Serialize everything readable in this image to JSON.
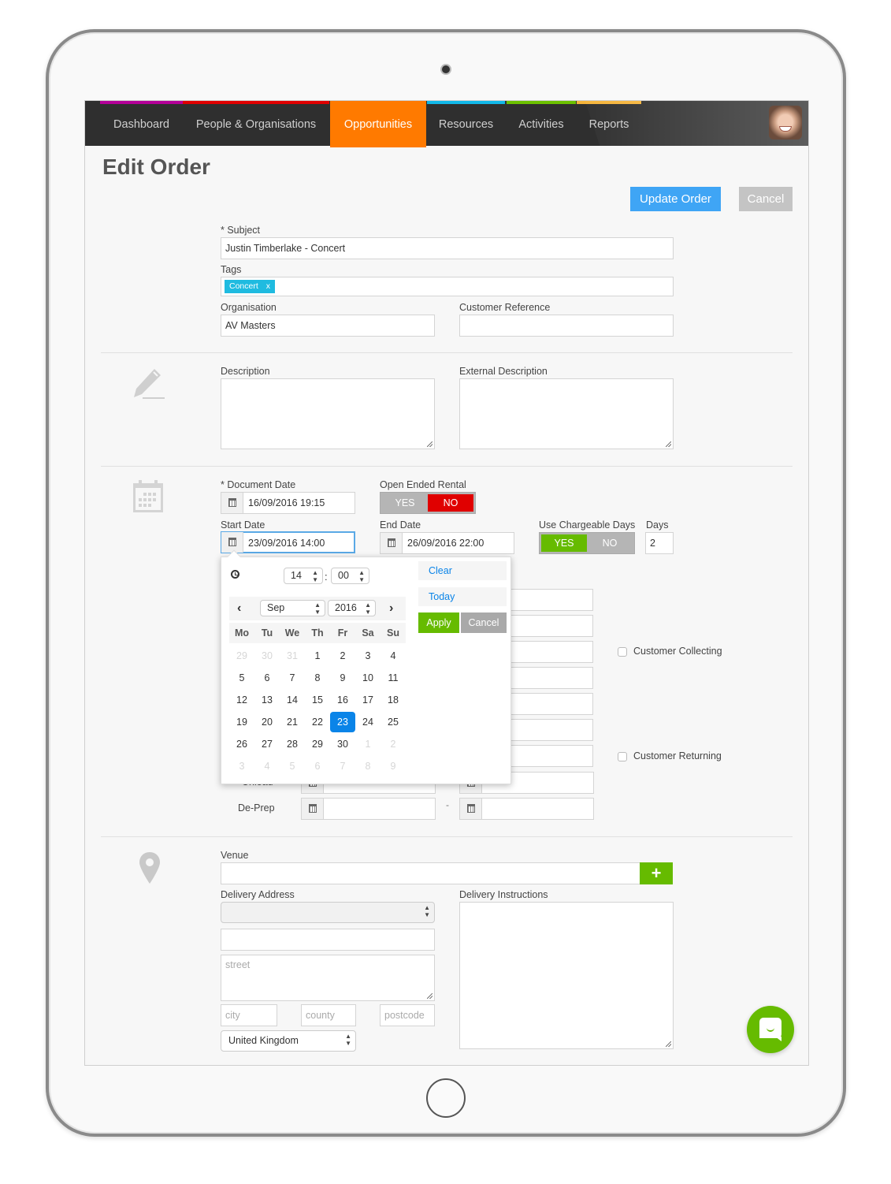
{
  "nav": {
    "items": [
      {
        "label": "Dashboard",
        "color": "#b40098"
      },
      {
        "label": "People & Organisations",
        "color": "#e00000"
      },
      {
        "label": "Opportunities",
        "color": "#ff7a00",
        "active": true
      },
      {
        "label": "Resources",
        "color": "#12b8e8"
      },
      {
        "label": "Activities",
        "color": "#6cc100"
      },
      {
        "label": "Reports",
        "color": "#f5b43a"
      }
    ],
    "active_color": "#ff7a00"
  },
  "header": {
    "title": "Edit Order",
    "update_label": "Update Order",
    "cancel_label": "Cancel"
  },
  "form": {
    "subject": {
      "label": "* Subject",
      "value": "Justin Timberlake - Concert"
    },
    "tags": {
      "label": "Tags",
      "items": [
        {
          "text": "Concert",
          "remove": "x"
        }
      ]
    },
    "organisation": {
      "label": "Organisation",
      "value": "AV Masters"
    },
    "customer_reference": {
      "label": "Customer Reference",
      "value": ""
    },
    "description": {
      "label": "Description",
      "value": ""
    },
    "external_description": {
      "label": "External Description",
      "value": ""
    },
    "document_date": {
      "label": "* Document Date",
      "value": "16/09/2016 19:15"
    },
    "open_ended_rental": {
      "label": "Open Ended Rental",
      "yes": "YES",
      "no": "NO",
      "selected": "NO"
    },
    "start_date": {
      "label": "Start Date",
      "value": "23/09/2016 14:00"
    },
    "end_date": {
      "label": "End Date",
      "value": "26/09/2016 22:00"
    },
    "use_chargeable_days": {
      "label": "Use Chargeable Days",
      "yes": "YES",
      "no": "NO",
      "selected": "YES"
    },
    "days": {
      "label": "Days",
      "value": "2"
    },
    "customer_collecting": {
      "label": "Customer Collecting",
      "checked": false
    },
    "customer_returning": {
      "label": "Customer Returning",
      "checked": false
    },
    "unload": {
      "label": "Unload"
    },
    "deprep": {
      "label": "De-Prep",
      "separator": "-"
    },
    "venue": {
      "label": "Venue",
      "value": "",
      "add_label": "+"
    },
    "delivery_address": {
      "label": "Delivery Address",
      "select_value": "",
      "name_value": "",
      "street_placeholder": "street",
      "city_placeholder": "city",
      "county_placeholder": "county",
      "postcode_placeholder": "postcode",
      "country": "United Kingdom"
    },
    "delivery_instructions": {
      "label": "Delivery Instructions",
      "value": ""
    }
  },
  "datepicker": {
    "hour": "14",
    "minute": "00",
    "time_separator": ":",
    "month": "Sep",
    "year": "2016",
    "prev": "‹",
    "next": "›",
    "weekdays": [
      "Mo",
      "Tu",
      "We",
      "Th",
      "Fr",
      "Sa",
      "Su"
    ],
    "weeks": [
      [
        {
          "d": "29",
          "m": true
        },
        {
          "d": "30",
          "m": true
        },
        {
          "d": "31",
          "m": true
        },
        {
          "d": "1"
        },
        {
          "d": "2"
        },
        {
          "d": "3"
        },
        {
          "d": "4"
        }
      ],
      [
        {
          "d": "5"
        },
        {
          "d": "6"
        },
        {
          "d": "7"
        },
        {
          "d": "8"
        },
        {
          "d": "9"
        },
        {
          "d": "10"
        },
        {
          "d": "11"
        }
      ],
      [
        {
          "d": "12"
        },
        {
          "d": "13"
        },
        {
          "d": "14"
        },
        {
          "d": "15"
        },
        {
          "d": "16"
        },
        {
          "d": "17"
        },
        {
          "d": "18"
        }
      ],
      [
        {
          "d": "19"
        },
        {
          "d": "20"
        },
        {
          "d": "21"
        },
        {
          "d": "22"
        },
        {
          "d": "23",
          "sel": true
        },
        {
          "d": "24"
        },
        {
          "d": "25"
        }
      ],
      [
        {
          "d": "26"
        },
        {
          "d": "27"
        },
        {
          "d": "28"
        },
        {
          "d": "29"
        },
        {
          "d": "30"
        },
        {
          "d": "1",
          "m": true
        },
        {
          "d": "2",
          "m": true
        }
      ],
      [
        {
          "d": "3",
          "m": true
        },
        {
          "d": "4",
          "m": true
        },
        {
          "d": "5",
          "m": true
        },
        {
          "d": "6",
          "m": true
        },
        {
          "d": "7",
          "m": true
        },
        {
          "d": "8",
          "m": true
        },
        {
          "d": "9",
          "m": true
        }
      ]
    ],
    "clear_label": "Clear",
    "today_label": "Today",
    "apply_label": "Apply",
    "cancel_label": "Cancel"
  }
}
